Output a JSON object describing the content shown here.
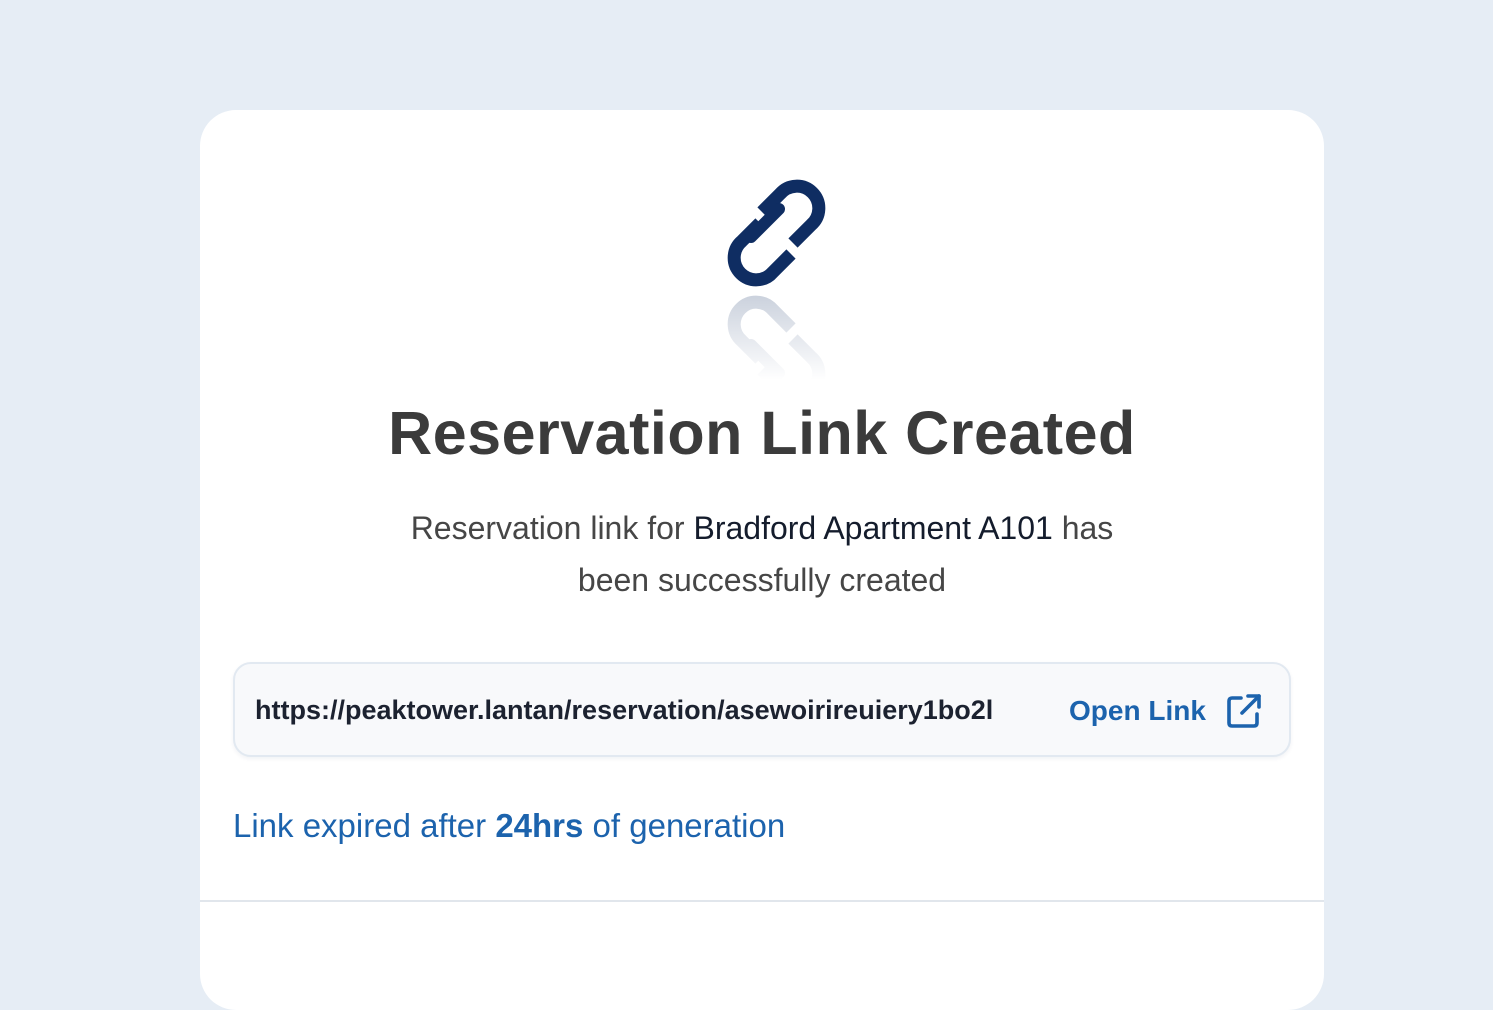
{
  "dialog": {
    "icon": "link-icon",
    "title": "Reservation Link Created",
    "message_prefix": "Reservation link for",
    "property_name": "Bradford Apartment A101",
    "message_suffix": "has",
    "message_line2": "been successfully created",
    "link": {
      "url": "https://peaktower.lantan/reservation/asewoirireuiery1bo2l",
      "open_label": "Open Link",
      "open_icon": "external-link-icon"
    },
    "expiry": {
      "prefix": "Link expired after",
      "duration": "24hrs",
      "suffix": "of generation"
    }
  },
  "colors": {
    "background": "#e6edf5",
    "card": "#ffffff",
    "icon": "#0f2d62",
    "accent": "#1c63ad",
    "title": "#3b3b3b"
  }
}
